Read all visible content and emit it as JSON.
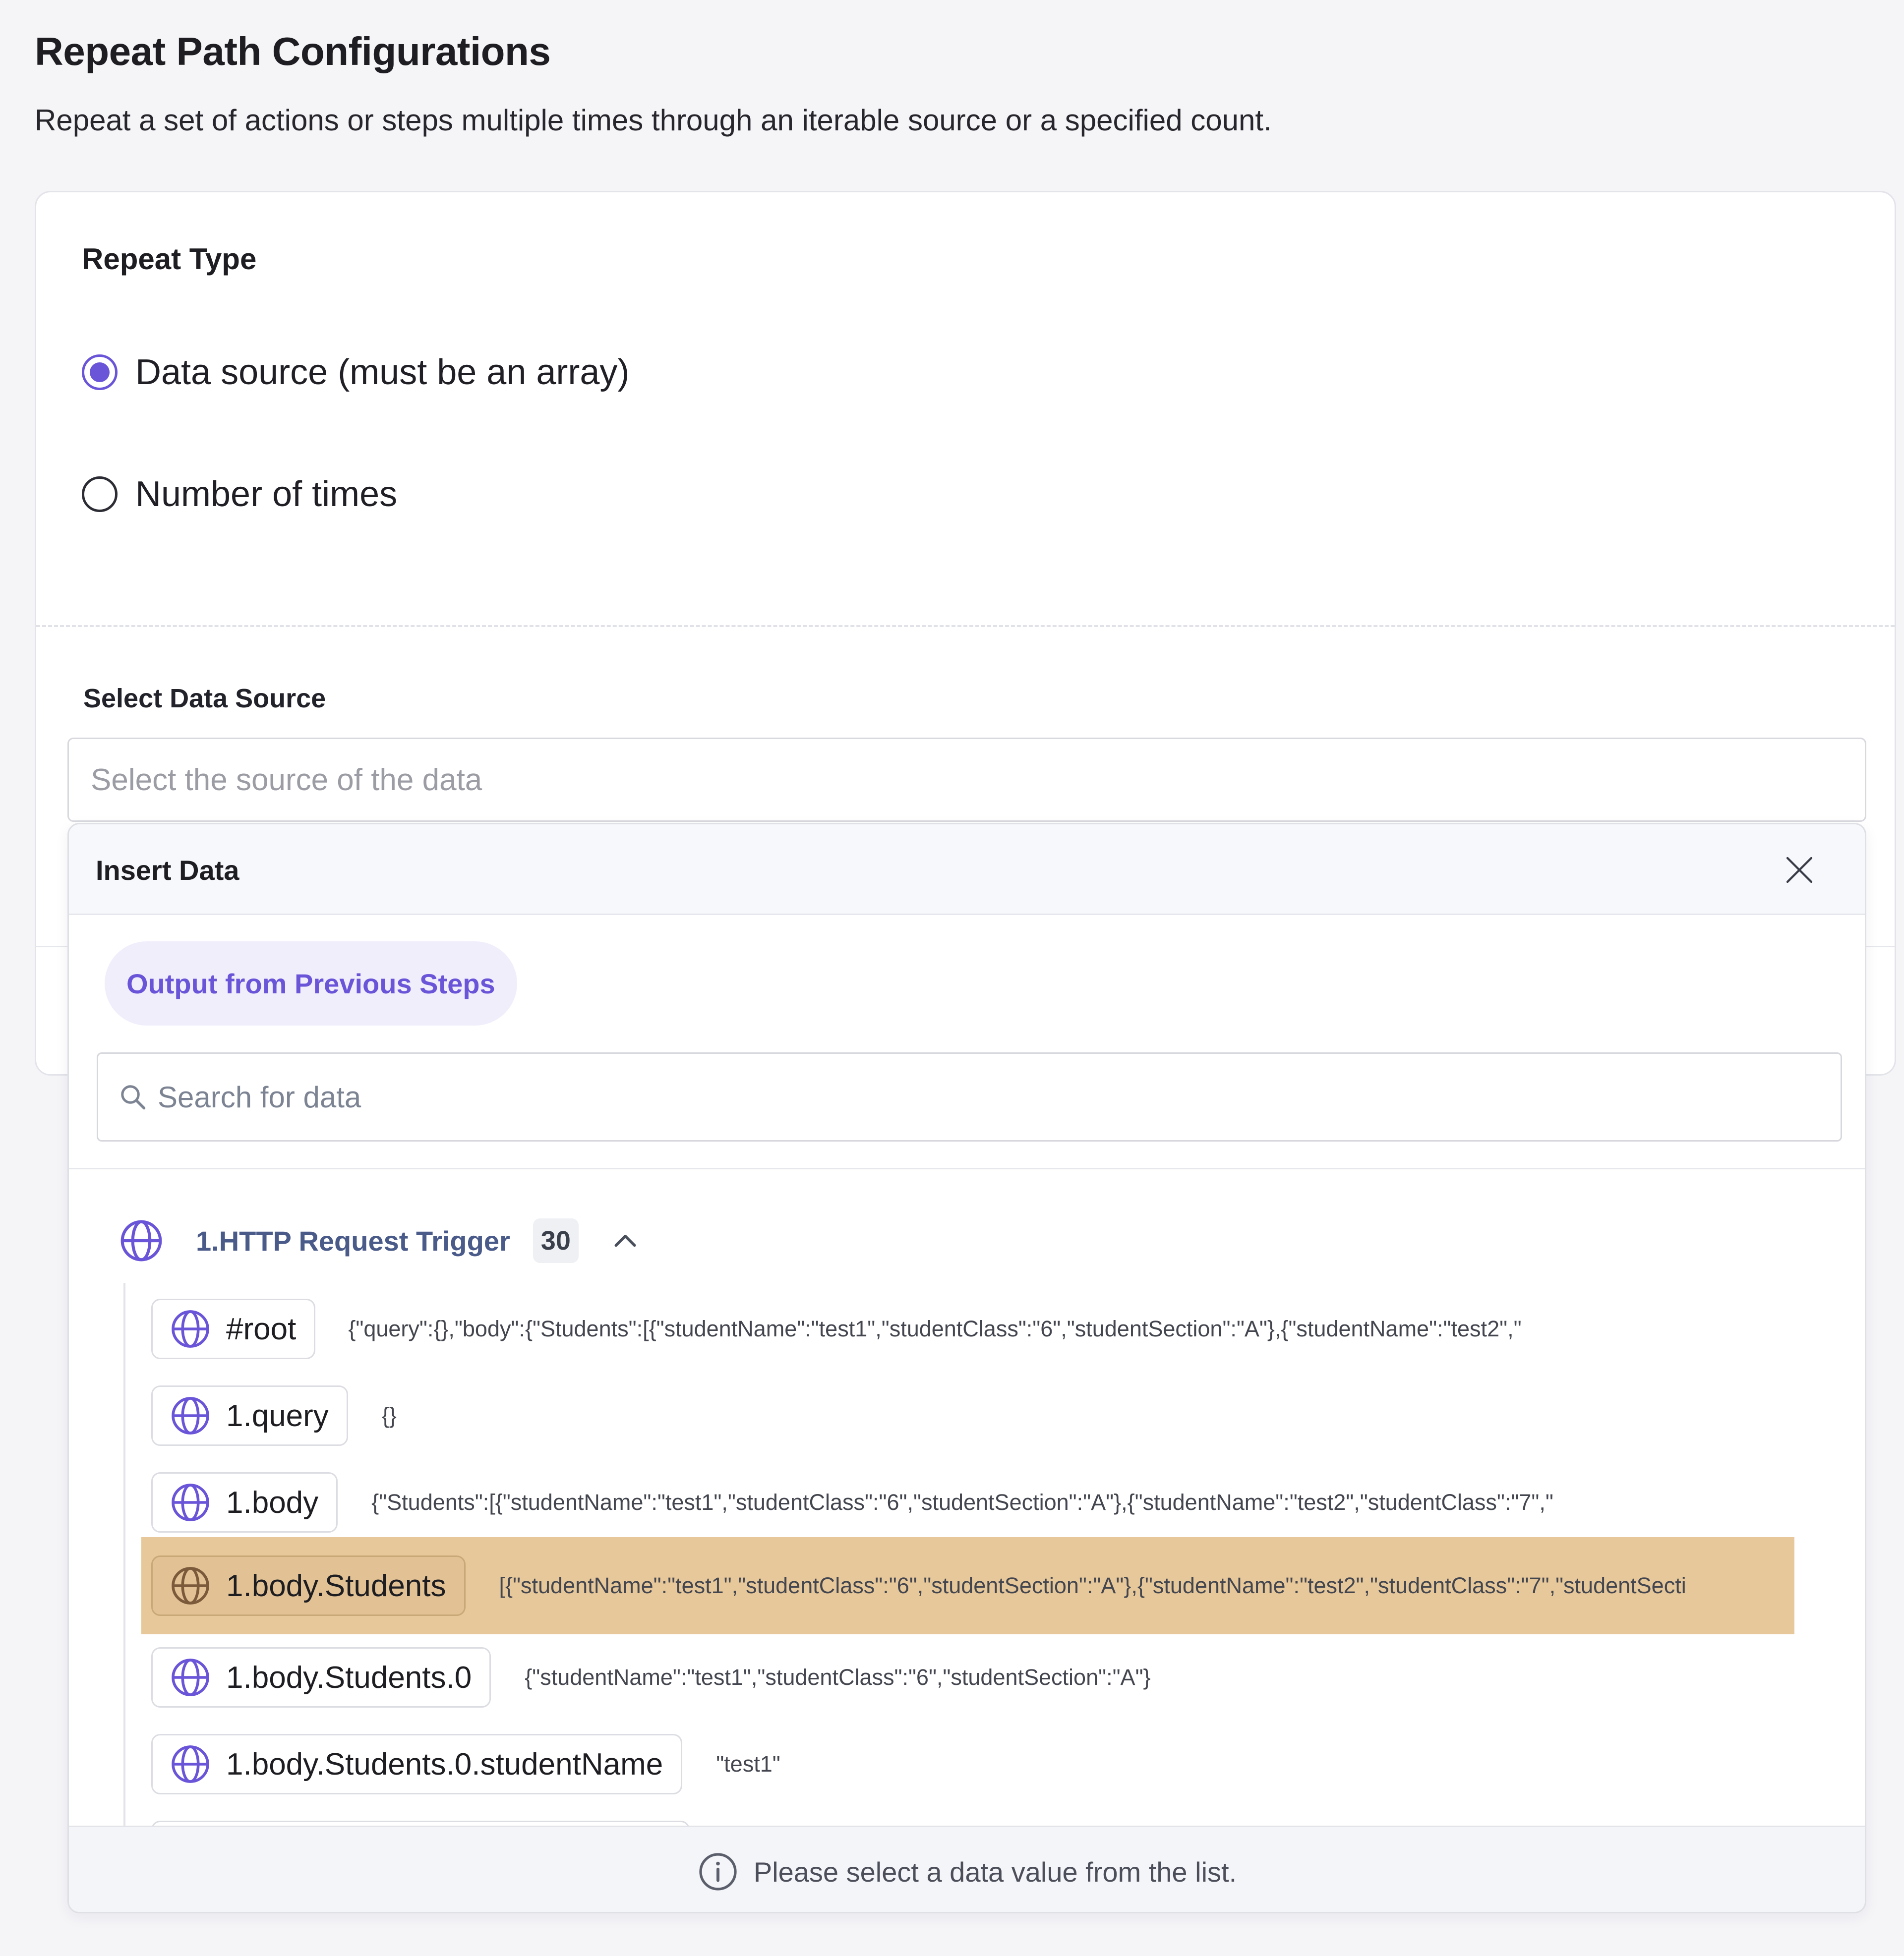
{
  "page": {
    "title": "Repeat Path Configurations",
    "description": "Repeat a set of actions or steps multiple times through an iterable source or a specified count."
  },
  "repeat_type": {
    "label": "Repeat Type",
    "options": [
      {
        "label": "Data source (must be an array)",
        "checked": true
      },
      {
        "label": "Number of times",
        "checked": false
      }
    ]
  },
  "data_source": {
    "label": "Select Data Source",
    "placeholder": "Select the source of the data"
  },
  "insert_panel": {
    "title": "Insert Data",
    "tab_label": "Output from Previous Steps",
    "search_placeholder": "Search for data",
    "group": {
      "title": "1.HTTP Request Trigger",
      "count": "30",
      "expanded": true
    },
    "rows": [
      {
        "label": "#root",
        "value": "{\"query\":{},\"body\":{\"Students\":[{\"studentName\":\"test1\",\"studentClass\":\"6\",\"studentSection\":\"A\"},{\"studentName\":\"test2\",\"",
        "selected": false
      },
      {
        "label": "1.query",
        "value": "{}",
        "selected": false
      },
      {
        "label": "1.body",
        "value": "{\"Students\":[{\"studentName\":\"test1\",\"studentClass\":\"6\",\"studentSection\":\"A\"},{\"studentName\":\"test2\",\"studentClass\":\"7\",\"",
        "selected": false
      },
      {
        "label": "1.body.Students",
        "value": "[{\"studentName\":\"test1\",\"studentClass\":\"6\",\"studentSection\":\"A\"},{\"studentName\":\"test2\",\"studentClass\":\"7\",\"studentSecti",
        "selected": true
      },
      {
        "label": "1.body.Students.0",
        "value": "{\"studentName\":\"test1\",\"studentClass\":\"6\",\"studentSection\":\"A\"}",
        "selected": false
      },
      {
        "label": "1.body.Students.0.studentName",
        "value": "\"test1\"",
        "selected": false
      }
    ],
    "footer_text": "Please select a data value from the list."
  },
  "colors": {
    "accent": "#6a55d8",
    "selected_row": "#e7c89a",
    "group_title": "#4a5b8a"
  },
  "icons": {
    "row": "globe-icon",
    "close": "close-icon",
    "search": "search-icon",
    "collapse": "chevron-up-icon",
    "info": "info-icon"
  }
}
